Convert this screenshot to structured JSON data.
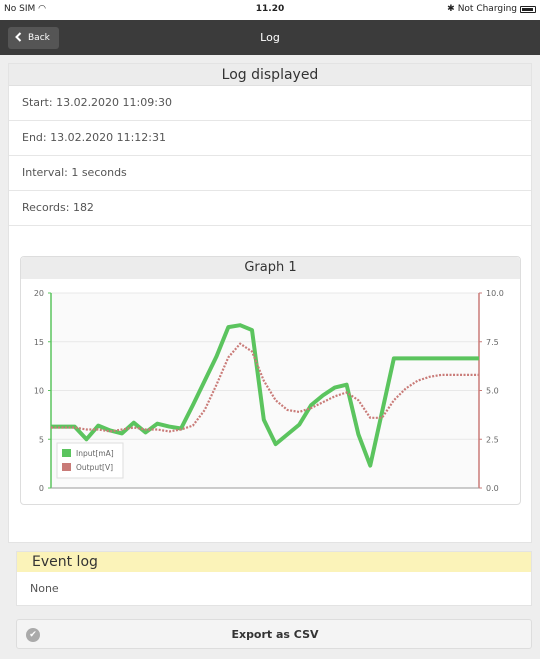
{
  "status_bar": {
    "carrier": "No SIM",
    "wifi_icon": "wifi-icon",
    "time": "11.20",
    "bluetooth": "✱",
    "charging": "Not Charging",
    "battery_icon": "battery-icon"
  },
  "nav": {
    "back_label": "Back",
    "title": "Log"
  },
  "log": {
    "header": "Log displayed",
    "start": "Start: 13.02.2020 11:09:30",
    "end": "End: 13.02.2020 11:12:31",
    "interval": "Interval: 1 seconds",
    "records": "Records: 182"
  },
  "graph": {
    "title": "Graph 1"
  },
  "colors": {
    "input": "#5bc45e",
    "output": "#c97b78",
    "nav_bg": "#3b3b3b",
    "event_header": "#fbf3b9"
  },
  "chart_data": {
    "type": "line",
    "title": "Graph 1",
    "x": [
      0,
      5,
      10,
      15,
      20,
      25,
      30,
      35,
      40,
      45,
      50,
      55,
      60,
      65,
      70,
      75,
      80,
      85,
      90,
      95,
      100,
      105,
      110,
      115,
      120,
      125,
      130,
      135,
      140,
      145,
      150,
      155,
      160,
      165,
      170,
      175,
      181
    ],
    "series": [
      {
        "name": "Input[mA]",
        "axis": "left",
        "values": [
          6.3,
          6.3,
          6.3,
          5.0,
          6.4,
          5.9,
          5.6,
          6.7,
          5.7,
          6.6,
          6.3,
          6.1,
          8.5,
          11.0,
          13.5,
          16.5,
          16.7,
          16.2,
          7.0,
          4.5,
          5.5,
          6.5,
          8.5,
          9.5,
          10.3,
          10.6,
          5.5,
          2.3,
          7.8,
          13.3,
          13.3,
          13.3,
          13.3,
          13.3,
          13.3,
          13.3,
          13.3
        ]
      },
      {
        "name": "Output[V]",
        "axis": "right",
        "values": [
          3.1,
          3.1,
          3.1,
          3.0,
          3.0,
          2.9,
          3.0,
          3.1,
          3.0,
          3.0,
          2.9,
          3.0,
          3.2,
          4.0,
          5.3,
          6.7,
          7.4,
          7.0,
          5.5,
          4.5,
          4.0,
          3.9,
          4.1,
          4.4,
          4.7,
          4.9,
          4.5,
          3.6,
          3.6,
          4.5,
          5.1,
          5.5,
          5.7,
          5.8,
          5.8,
          5.8,
          5.8
        ]
      }
    ],
    "ylim_left": [
      0,
      20
    ],
    "ylim_right": [
      0,
      10
    ],
    "yticks_left": [
      "0",
      "5",
      "10",
      "15",
      "20"
    ],
    "yticks_right": [
      "0.0",
      "2.5",
      "5.0",
      "7.5",
      "10.0"
    ],
    "grid": true,
    "legend": "bottom-left"
  },
  "event_log": {
    "header": "Event log",
    "body": "None"
  },
  "export": {
    "label": "Export as CSV",
    "icon": "checkmark-circle-icon"
  }
}
